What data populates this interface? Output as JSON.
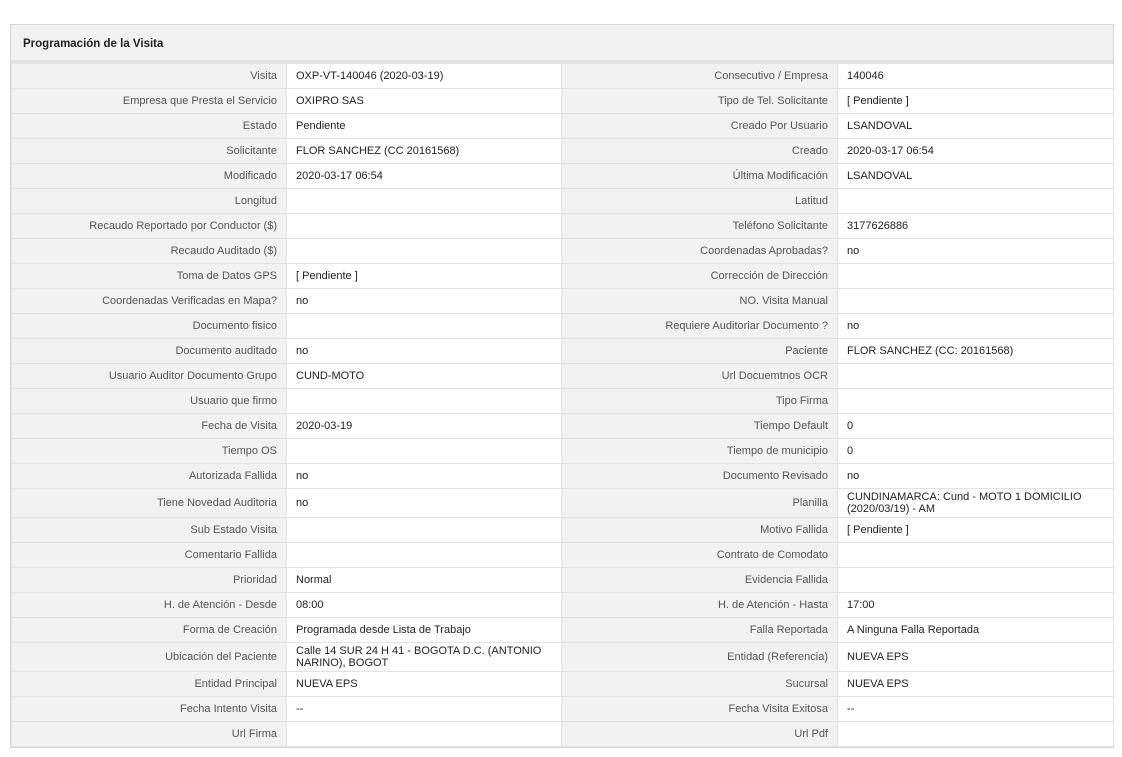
{
  "panel": {
    "title": "Programación de la Visita",
    "rows": [
      {
        "l1": "Visita",
        "v1": "OXP-VT-140046 (2020-03-19)",
        "l2": "Consecutivo / Empresa",
        "v2": "140046"
      },
      {
        "l1": "Empresa que Presta el Servicio",
        "v1": "OXIPRO SAS",
        "l2": "Tipo de Tel. Solicitante",
        "v2": "[ Pendiente ]"
      },
      {
        "l1": "Estado",
        "v1": "Pendiente",
        "l2": "Creado Por Usuario",
        "v2": "LSANDOVAL"
      },
      {
        "l1": "Solicitante",
        "v1": "FLOR SANCHEZ (CC 20161568)",
        "l2": "Creado",
        "v2": "2020-03-17 06:54"
      },
      {
        "l1": "Modificado",
        "v1": "2020-03-17 06:54",
        "l2": "Última Modificación",
        "v2": "LSANDOVAL"
      },
      {
        "l1": "Longitud",
        "v1": "",
        "l2": "Latitud",
        "v2": ""
      },
      {
        "l1": "Recaudo Reportado por Conductor ($)",
        "v1": "",
        "l2": "Teléfono Solicitante",
        "v2": "3177626886"
      },
      {
        "l1": "Recaudo Auditado ($)",
        "v1": "",
        "l2": "Coordenadas Aprobadas?",
        "v2": "no"
      },
      {
        "l1": "Toma de Datos GPS",
        "v1": "[ Pendiente ]",
        "l2": "Corrección de Dirección",
        "v2": ""
      },
      {
        "l1": "Coordenadas Verificadas en Mapa?",
        "v1": "no",
        "l2": "NO. Visita Manual",
        "v2": ""
      },
      {
        "l1": "Documento fisico",
        "v1": "",
        "l2": "Requiere Auditoriar Documento ?",
        "v2": "no"
      },
      {
        "l1": "Documento auditado",
        "v1": "no",
        "l2": "Paciente",
        "v2": "FLOR SANCHEZ (CC: 20161568)"
      },
      {
        "l1": "Usuario Auditor Documento Grupo",
        "v1": "CUND-MOTO",
        "l2": "Url Docuemtnos OCR",
        "v2": ""
      },
      {
        "l1": "Usuario que firmo",
        "v1": "",
        "l2": "Tipo Firma",
        "v2": ""
      },
      {
        "l1": "Fecha de Visita",
        "v1": "2020-03-19",
        "l2": "Tiempo Default",
        "v2": "0"
      },
      {
        "l1": "Tiempo OS",
        "v1": "",
        "l2": "Tiempo de municipio",
        "v2": "0"
      },
      {
        "l1": "Autorizada Fallida",
        "v1": "no",
        "l2": "Documento Revisado",
        "v2": "no"
      },
      {
        "l1": "Tiene Novedad Auditoria",
        "v1": "no",
        "l2": "Planilla",
        "v2": "CUNDINAMARCA: Cund - MOTO 1 DOMICILIO (2020/03/19) - AM"
      },
      {
        "l1": "Sub Estado Visita",
        "v1": "",
        "l2": "Motivo Fallida",
        "v2": "[ Pendiente ]"
      },
      {
        "l1": "Comentario Fallida",
        "v1": "",
        "l2": "Contrato de Comodato",
        "v2": ""
      },
      {
        "l1": "Prioridad",
        "v1": "Normal",
        "l2": "Evidencia Fallida",
        "v2": ""
      },
      {
        "l1": "H. de Atención - Desde",
        "v1": "08:00",
        "l2": "H. de Atención - Hasta",
        "v2": "17:00"
      },
      {
        "l1": "Forma de Creación",
        "v1": "Programada desde Lista de Trabajo",
        "l2": "Falla Reportada",
        "v2": "A Ninguna Falla Reportada"
      },
      {
        "l1": "Ubicación del Paciente",
        "v1": "Calle 14 SUR 24 H 41 - BOGOTA D.C. (ANTONIO NARINO), BOGOT",
        "l2": "Entidad (Referencia)",
        "v2": "NUEVA EPS"
      },
      {
        "l1": "Entidad Principal",
        "v1": "NUEVA EPS",
        "l2": "Sucursal",
        "v2": "NUEVA EPS"
      },
      {
        "l1": "Fecha Intento Visita",
        "v1": "--",
        "l2": "Fecha Visita Exitosa",
        "v2": "--"
      },
      {
        "l1": "Url Firma",
        "v1": "",
        "l2": "Url Pdf",
        "v2": ""
      }
    ]
  }
}
